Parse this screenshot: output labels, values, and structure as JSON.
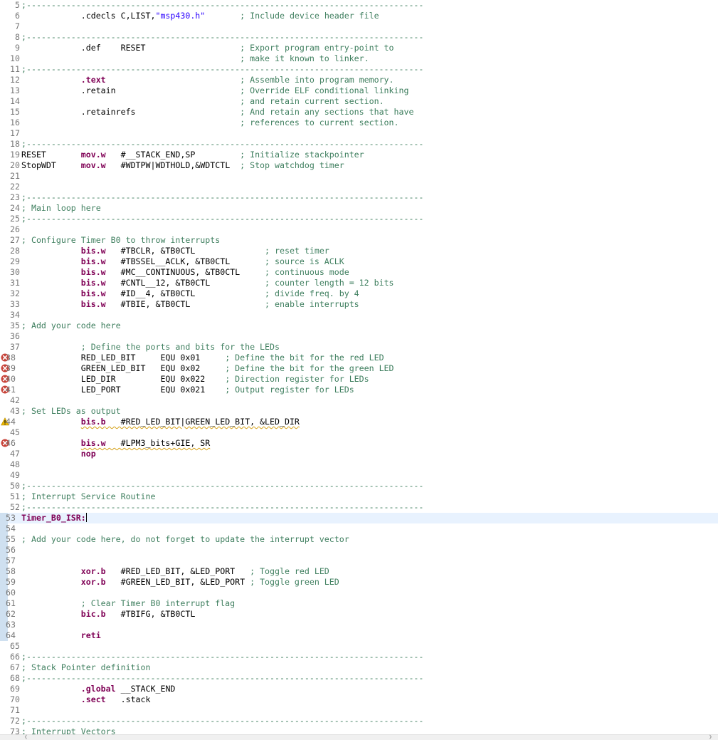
{
  "editor": {
    "lines": [
      {
        "no": "5",
        "code": [
          {
            "t": ";--------------------------------------------------------------------------------",
            "c": "c"
          }
        ]
      },
      {
        "no": "6",
        "code": [
          {
            "t": "            .cdecls C,LIST,"
          },
          {
            "t": "\"msp430.h\"",
            "c": "s"
          },
          {
            "t": "       "
          },
          {
            "t": "; Include device header file",
            "c": "c"
          }
        ]
      },
      {
        "no": "7",
        "code": []
      },
      {
        "no": "8",
        "code": [
          {
            "t": ";--------------------------------------------------------------------------------",
            "c": "c"
          }
        ]
      },
      {
        "no": "9",
        "code": [
          {
            "t": "            .def    RESET                   "
          },
          {
            "t": "; Export program entry-point to",
            "c": "c"
          }
        ]
      },
      {
        "no": "10",
        "code": [
          {
            "t": "                                            "
          },
          {
            "t": "; make it known to linker.",
            "c": "c"
          }
        ]
      },
      {
        "no": "11",
        "code": [
          {
            "t": ";--------------------------------------------------------------------------------",
            "c": "c"
          }
        ]
      },
      {
        "no": "12",
        "code": [
          {
            "t": "            "
          },
          {
            "t": ".text",
            "c": "k"
          },
          {
            "t": "                           "
          },
          {
            "t": "; Assemble into program memory.",
            "c": "c"
          }
        ]
      },
      {
        "no": "13",
        "code": [
          {
            "t": "            .retain                         "
          },
          {
            "t": "; Override ELF conditional linking",
            "c": "c"
          }
        ]
      },
      {
        "no": "14",
        "code": [
          {
            "t": "                                            "
          },
          {
            "t": "; and retain current section.",
            "c": "c"
          }
        ]
      },
      {
        "no": "15",
        "code": [
          {
            "t": "            .retainrefs                     "
          },
          {
            "t": "; And retain any sections that have",
            "c": "c"
          }
        ]
      },
      {
        "no": "16",
        "code": [
          {
            "t": "                                            "
          },
          {
            "t": "; references to current section.",
            "c": "c"
          }
        ]
      },
      {
        "no": "17",
        "code": []
      },
      {
        "no": "18",
        "code": [
          {
            "t": ";--------------------------------------------------------------------------------",
            "c": "c"
          }
        ]
      },
      {
        "no": "19",
        "code": [
          {
            "t": "RESET       "
          },
          {
            "t": "mov.w",
            "c": "k"
          },
          {
            "t": "   #__STACK_END,SP         "
          },
          {
            "t": "; Initialize stackpointer",
            "c": "c"
          }
        ]
      },
      {
        "no": "20",
        "code": [
          {
            "t": "StopWDT     "
          },
          {
            "t": "mov.w",
            "c": "k"
          },
          {
            "t": "   #WDTPW|WDTHOLD,&WDTCTL  "
          },
          {
            "t": "; Stop watchdog timer",
            "c": "c"
          }
        ]
      },
      {
        "no": "21",
        "code": []
      },
      {
        "no": "22",
        "code": []
      },
      {
        "no": "23",
        "code": [
          {
            "t": ";--------------------------------------------------------------------------------",
            "c": "c"
          }
        ]
      },
      {
        "no": "24",
        "code": [
          {
            "t": "; Main loop here",
            "c": "c"
          }
        ]
      },
      {
        "no": "25",
        "code": [
          {
            "t": ";--------------------------------------------------------------------------------",
            "c": "c"
          }
        ]
      },
      {
        "no": "26",
        "code": []
      },
      {
        "no": "27",
        "code": [
          {
            "t": "; Configure Timer B0 to throw interrupts",
            "c": "c"
          }
        ]
      },
      {
        "no": "28",
        "code": [
          {
            "t": "            "
          },
          {
            "t": "bis.w",
            "c": "k"
          },
          {
            "t": "   #TBCLR, &TB0CTL              "
          },
          {
            "t": "; reset timer",
            "c": "c"
          }
        ]
      },
      {
        "no": "29",
        "code": [
          {
            "t": "            "
          },
          {
            "t": "bis.w",
            "c": "k"
          },
          {
            "t": "   #TBSSEL__ACLK, &TB0CTL       "
          },
          {
            "t": "; source is ACLK",
            "c": "c"
          }
        ]
      },
      {
        "no": "30",
        "code": [
          {
            "t": "            "
          },
          {
            "t": "bis.w",
            "c": "k"
          },
          {
            "t": "   #MC__CONTINUOUS, &TB0CTL     "
          },
          {
            "t": "; continuous mode",
            "c": "c"
          }
        ]
      },
      {
        "no": "31",
        "code": [
          {
            "t": "            "
          },
          {
            "t": "bis.w",
            "c": "k"
          },
          {
            "t": "   #CNTL__12, &TB0CTL           "
          },
          {
            "t": "; counter length = 12 bits",
            "c": "c"
          }
        ]
      },
      {
        "no": "32",
        "code": [
          {
            "t": "            "
          },
          {
            "t": "bis.w",
            "c": "k"
          },
          {
            "t": "   #ID__4, &TB0CTL              "
          },
          {
            "t": "; divide freq. by 4",
            "c": "c"
          }
        ]
      },
      {
        "no": "33",
        "code": [
          {
            "t": "            "
          },
          {
            "t": "bis.w",
            "c": "k"
          },
          {
            "t": "   #TBIE, &TB0CTL               "
          },
          {
            "t": "; enable interrupts",
            "c": "c"
          }
        ]
      },
      {
        "no": "34",
        "code": []
      },
      {
        "no": "35",
        "code": [
          {
            "t": "; Add your code here",
            "c": "c"
          }
        ]
      },
      {
        "no": "36",
        "code": []
      },
      {
        "no": "37",
        "code": [
          {
            "t": "            "
          },
          {
            "t": "; Define the ports and bits for the LEDs",
            "c": "c"
          }
        ]
      },
      {
        "no": "38",
        "marker": "error",
        "code": [
          {
            "t": "            RED_LED_BIT     EQU 0x01     "
          },
          {
            "t": "; Define the bit for the red LED",
            "c": "c"
          }
        ]
      },
      {
        "no": "39",
        "marker": "error",
        "code": [
          {
            "t": "            GREEN_LED_BIT   EQU 0x02     "
          },
          {
            "t": "; Define the bit for the green LED",
            "c": "c"
          }
        ]
      },
      {
        "no": "40",
        "marker": "error",
        "code": [
          {
            "t": "            LED_DIR         EQU 0x022    "
          },
          {
            "t": "; Direction register for LEDs",
            "c": "c"
          }
        ]
      },
      {
        "no": "41",
        "marker": "error",
        "code": [
          {
            "t": "            LED_PORT        EQU 0x021    "
          },
          {
            "t": "; Output register for LEDs",
            "c": "c"
          }
        ]
      },
      {
        "no": "42",
        "code": []
      },
      {
        "no": "43",
        "code": [
          {
            "t": "; Set LEDs as output",
            "c": "c"
          }
        ]
      },
      {
        "no": "44",
        "marker": "warning",
        "code": [
          {
            "t": "            "
          },
          {
            "t": "bis.b",
            "c": "k",
            "w": true
          },
          {
            "t": "   #RED_LED_BIT|GREEN_LED_BIT, &LED_DIR",
            "w": true
          }
        ]
      },
      {
        "no": "45",
        "code": []
      },
      {
        "no": "46",
        "marker": "error",
        "code": [
          {
            "t": "            "
          },
          {
            "t": "bis.w",
            "c": "k",
            "w": true
          },
          {
            "t": "   #LPM3_bits+GIE, SR",
            "w": true
          }
        ]
      },
      {
        "no": "47",
        "code": [
          {
            "t": "            "
          },
          {
            "t": "nop",
            "c": "k"
          }
        ]
      },
      {
        "no": "48",
        "code": []
      },
      {
        "no": "49",
        "code": []
      },
      {
        "no": "50",
        "code": [
          {
            "t": ";--------------------------------------------------------------------------------",
            "c": "c"
          }
        ]
      },
      {
        "no": "51",
        "code": [
          {
            "t": "; Interrupt Service Routine",
            "c": "c"
          }
        ]
      },
      {
        "no": "52",
        "code": [
          {
            "t": ";--------------------------------------------------------------------------------",
            "c": "c"
          }
        ]
      },
      {
        "no": "53",
        "current": true,
        "scope": true,
        "caret": true,
        "code": [
          {
            "t": "Timer_B0_ISR:",
            "c": "lbl"
          }
        ]
      },
      {
        "no": "54",
        "scope": true,
        "code": []
      },
      {
        "no": "55",
        "scope": true,
        "code": [
          {
            "t": "; Add your code here, do not forget to update the interrupt vector",
            "c": "c"
          }
        ]
      },
      {
        "no": "56",
        "scope": true,
        "code": []
      },
      {
        "no": "57",
        "scope": true,
        "code": []
      },
      {
        "no": "58",
        "scope": true,
        "code": [
          {
            "t": "            "
          },
          {
            "t": "xor.b",
            "c": "k"
          },
          {
            "t": "   #RED_LED_BIT, &LED_PORT   "
          },
          {
            "t": "; Toggle red LED",
            "c": "c"
          }
        ]
      },
      {
        "no": "59",
        "scope": true,
        "code": [
          {
            "t": "            "
          },
          {
            "t": "xor.b",
            "c": "k"
          },
          {
            "t": "   #GREEN_LED_BIT, &LED_PORT "
          },
          {
            "t": "; Toggle green LED",
            "c": "c"
          }
        ]
      },
      {
        "no": "60",
        "scope": true,
        "code": []
      },
      {
        "no": "61",
        "scope": true,
        "code": [
          {
            "t": "            "
          },
          {
            "t": "; Clear Timer B0 interrupt flag",
            "c": "c"
          }
        ]
      },
      {
        "no": "62",
        "scope": true,
        "code": [
          {
            "t": "            "
          },
          {
            "t": "bic.b",
            "c": "k"
          },
          {
            "t": "   #TBIFG, &TB0CTL"
          }
        ]
      },
      {
        "no": "63",
        "scope": true,
        "code": []
      },
      {
        "no": "64",
        "scope": true,
        "code": [
          {
            "t": "            "
          },
          {
            "t": "reti",
            "c": "k"
          }
        ]
      },
      {
        "no": "65",
        "code": []
      },
      {
        "no": "66",
        "code": [
          {
            "t": ";--------------------------------------------------------------------------------",
            "c": "c"
          }
        ]
      },
      {
        "no": "67",
        "code": [
          {
            "t": "; Stack Pointer definition",
            "c": "c"
          }
        ]
      },
      {
        "no": "68",
        "code": [
          {
            "t": ";--------------------------------------------------------------------------------",
            "c": "c"
          }
        ]
      },
      {
        "no": "69",
        "code": [
          {
            "t": "            "
          },
          {
            "t": ".global",
            "c": "k"
          },
          {
            "t": " __STACK_END"
          }
        ]
      },
      {
        "no": "70",
        "code": [
          {
            "t": "            "
          },
          {
            "t": ".sect",
            "c": "k"
          },
          {
            "t": "   .stack"
          }
        ]
      },
      {
        "no": "71",
        "code": []
      },
      {
        "no": "72",
        "code": [
          {
            "t": ";--------------------------------------------------------------------------------",
            "c": "c"
          }
        ]
      },
      {
        "no": "73",
        "code": [
          {
            "t": "; Interrupt Vectors",
            "c": "c"
          }
        ]
      }
    ]
  },
  "colors": {
    "comment": "#3f7f5f",
    "keyword": "#7f0055",
    "string": "#2a00ff",
    "current_line": "#e8f2fe",
    "error_marker": "#c8443a",
    "warning_marker": "#e8b400",
    "scope_bar": "#cfe0f0"
  },
  "icons": {
    "error": "error-marker-icon",
    "warning": "warning-marker-icon"
  }
}
